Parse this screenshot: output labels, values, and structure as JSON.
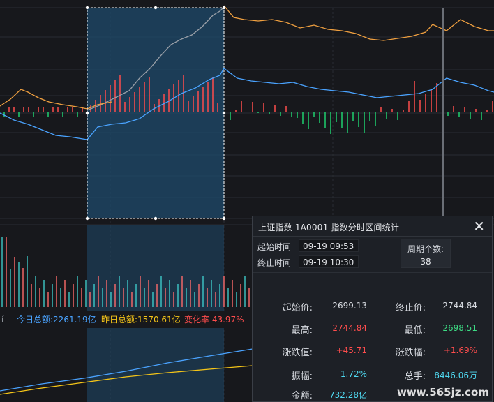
{
  "totals": {
    "prefix": "í",
    "today_label": "今日总额:2261.19亿",
    "yesterday_label": "昨日总额:1570.61亿",
    "change_label": "变化率 43.97%",
    "colors": {
      "today": "#4aa3ff",
      "yesterday": "#f5c518",
      "change": "#ff4d4d"
    }
  },
  "panel": {
    "title": "上证指数  1A0001  指数分时区间统计",
    "close_icon": "close-icon",
    "start_time_label": "起始时间",
    "start_time": "09-19 09:53",
    "end_time_label": "终止时间",
    "end_time": "09-19 10:30",
    "period_label": "周期个数:",
    "period_count": "38",
    "stats": [
      {
        "label": "起始价:",
        "value": "2699.13",
        "color": "#d7dae0"
      },
      {
        "label": "终止价:",
        "value": "2744.84",
        "color": "#d7dae0"
      },
      {
        "label": "最高:",
        "value": "2744.84",
        "color": "#ff4d4d"
      },
      {
        "label": "最低:",
        "value": "2698.51",
        "color": "#3ddc84"
      },
      {
        "label": "涨跌值:",
        "value": "+45.71",
        "color": "#ff4d4d"
      },
      {
        "label": "涨跌幅:",
        "value": "+1.69%",
        "color": "#ff4d4d"
      },
      {
        "label": "振幅:",
        "value": "1.72%",
        "color": "#4fd8f0"
      },
      {
        "label": "总手:",
        "value": "8446.06万",
        "color": "#4fd8f0"
      },
      {
        "label": "金额:",
        "value": "732.28亿",
        "color": "#4fd8f0"
      }
    ]
  },
  "watermark": "www.565jz.com",
  "colors": {
    "background": "#17181c",
    "grid": "#2a2d33",
    "selection_fill": "#1f4a6b",
    "price_line": "#f0a040",
    "avg_line": "#4aa3ff",
    "gray_line": "#9aa0a8",
    "up": "#ff4d4d",
    "down": "#1fd16f",
    "volume": "#3ec9c9",
    "cum_today": "#4aa3ff",
    "cum_yesterday": "#f5c518"
  }
}
